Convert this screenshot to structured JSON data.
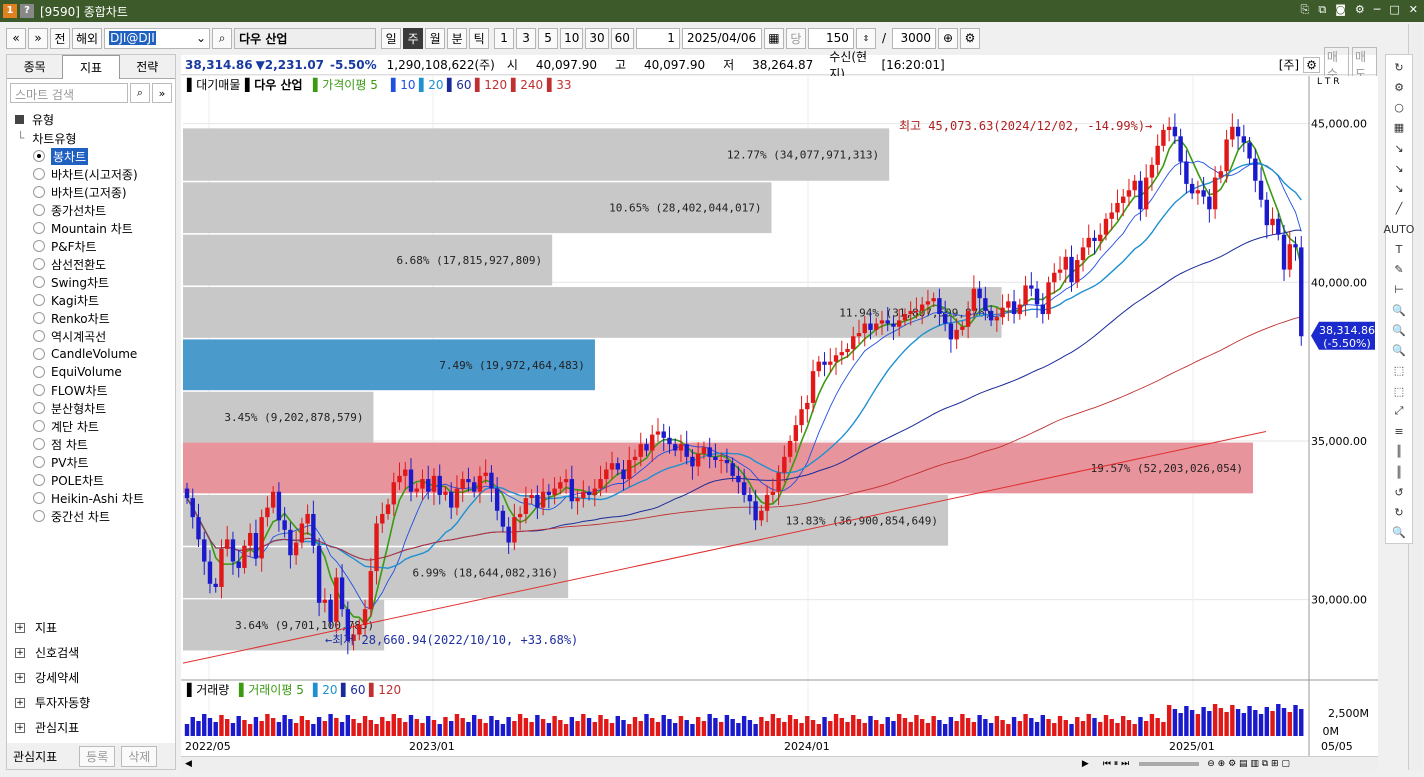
{
  "window": {
    "badge1": "1",
    "badge2": "?",
    "title": "[9590] 종합차트"
  },
  "toolbar": {
    "left_buttons": [
      "«",
      "»",
      "전",
      "해외"
    ],
    "symbol_code": "DJI@DJI",
    "symbol_name": "다우 산업",
    "period_buttons": [
      "일",
      "주",
      "월",
      "분",
      "틱"
    ],
    "period_active": "주",
    "interval_buttons": [
      "1",
      "3",
      "5",
      "10",
      "30",
      "60"
    ],
    "interval_value": "1",
    "date": "2025/04/06",
    "day_label": "당",
    "count": "150",
    "total": "3000",
    "slash": "/"
  },
  "left_panel": {
    "tabs": [
      "종목",
      "지표",
      "전략"
    ],
    "active_tab": "지표",
    "search_placeholder": "스마트 검색",
    "section": "유형",
    "tree_root": "차트유형",
    "chart_types": [
      "봉차트",
      "바차트(시고저종)",
      "바차트(고저종)",
      "종가선차트",
      "Mountain 차트",
      "P&F차트",
      "삼선전환도",
      "Swing차트",
      "Kagi차트",
      "Renko차트",
      "역시계곡선",
      "CandleVolume",
      "EquiVolume",
      "FLOW차트",
      "분산형차트",
      "계단 차트",
      "점 차트",
      "PV차트",
      "POLE차트",
      "Heikin-Ashi 차트",
      "중간선 차트"
    ],
    "selected_type": "봉차트",
    "bottom_sections": [
      "지표",
      "신호검색",
      "강세약세",
      "투자자동향",
      "관심지표"
    ],
    "footer": {
      "label": "관심지표",
      "register": "등록",
      "delete": "삭제"
    }
  },
  "infobar": {
    "price": "38,314.86",
    "change": "▼2,231.07",
    "rate": "-5.50%",
    "volume": "1,290,108,622(주)",
    "open_label": "시",
    "open": "40,097.90",
    "high_label": "고",
    "high": "40,097.90",
    "low_label": "저",
    "low": "38,264.87",
    "feed": "수신(현지)",
    "time": "[16:20:01]",
    "unit": "[주]",
    "buy": "매수",
    "sell": "매도"
  },
  "chart_legend": {
    "type": "대기매물",
    "name": "다우 산업",
    "ma_label": "가격이평",
    "ma_periods": [
      "5",
      "10",
      "20",
      "60",
      "120",
      "240",
      "33"
    ],
    "ma_colors": [
      "#3a9a10",
      "#2050e0",
      "#2090d0",
      "#1a2a9a",
      "#c03030",
      "#c03030",
      "#c03030"
    ]
  },
  "chart_data": {
    "type": "candlestick",
    "price_axis": {
      "ticks": [
        "45,000.00",
        "40,000.00",
        "35,000.00",
        "30,000.00"
      ],
      "tick_values": [
        45000,
        40000,
        35000,
        30000
      ],
      "range": [
        27500,
        46500
      ]
    },
    "time_axis": [
      "2022/05",
      "2023/01",
      "2024/01",
      "2025/01",
      "05/05"
    ],
    "current_price": "38,314.86",
    "current_rate": "(-5.50%)",
    "high_annotation": "최고 45,073.63(2024/12/02, -14.99%)→",
    "low_annotation": "←최저 28,660.94(2022/10/10, +33.68%)",
    "volume_profile": [
      {
        "range": [
          43200,
          44850
        ],
        "width": 0.66,
        "label": "12.77% (34,077,971,313)"
      },
      {
        "range": [
          41550,
          43150
        ],
        "width": 0.55,
        "label": "10.65% (28,402,044,017)"
      },
      {
        "range": [
          39900,
          41500
        ],
        "width": 0.345,
        "label": "6.68% (17,815,927,809)"
      },
      {
        "range": [
          38250,
          39850
        ],
        "width": 0.765,
        "label": "11.94% (31,807,599,876)"
      },
      {
        "range": [
          36600,
          38200
        ],
        "width": 0.385,
        "label": "7.49% (19,972,464,483)",
        "highlight": "blue"
      },
      {
        "range": [
          34950,
          36550
        ],
        "width": 0.178,
        "label": "3.45% (9,202,878,579)"
      },
      {
        "range": [
          33350,
          34950
        ],
        "width": 1.0,
        "label": "19.57% (52,203,026,054)",
        "highlight": "red"
      },
      {
        "range": [
          31700,
          33300
        ],
        "width": 0.715,
        "label": "13.83% (36,900,854,649)"
      },
      {
        "range": [
          30050,
          31650
        ],
        "width": 0.36,
        "label": "6.99% (18,644,082,316)"
      },
      {
        "range": [
          28400,
          30000
        ],
        "width": 0.188,
        "label": "3.64% (9,701,100,783)"
      }
    ],
    "closes": [
      33200,
      32600,
      31900,
      31200,
      30500,
      30400,
      31600,
      31900,
      31200,
      31000,
      31700,
      32100,
      31300,
      32600,
      32900,
      33400,
      32500,
      32200,
      31400,
      31800,
      32400,
      32700,
      31700,
      29900,
      30000,
      29300,
      30700,
      29700,
      28700,
      28900,
      29200,
      29700,
      30900,
      32400,
      32700,
      33000,
      33700,
      33900,
      34100,
      33400,
      33500,
      33800,
      33400,
      33900,
      33300,
      33400,
      32900,
      33500,
      33800,
      33700,
      33400,
      33900,
      34000,
      33500,
      32800,
      32300,
      31800,
      32600,
      32700,
      33200,
      33300,
      32900,
      33400,
      33300,
      33500,
      33700,
      33800,
      33100,
      33200,
      33400,
      33300,
      33500,
      33800,
      34100,
      34300,
      34100,
      33800,
      34400,
      34500,
      34900,
      34700,
      35200,
      35300,
      35100,
      34900,
      34700,
      34900,
      34500,
      34200,
      34600,
      34800,
      34500,
      34400,
      34400,
      34300,
      33900,
      33700,
      33300,
      33100,
      32500,
      32800,
      33300,
      33400,
      34000,
      34500,
      35000,
      35500,
      36000,
      36200,
      37200,
      37500,
      37400,
      37500,
      37700,
      37800,
      37900,
      38300,
      38400,
      38700,
      38500,
      38700,
      38800,
      38700,
      38600,
      38800,
      39000,
      39100,
      39100,
      39300,
      39400,
      39500,
      39000,
      38700,
      38200,
      38500,
      38600,
      39100,
      39800,
      39500,
      39100,
      38800,
      38900,
      39200,
      39400,
      39000,
      39300,
      39900,
      39800,
      39300,
      39000,
      40000,
      40300,
      40400,
      40800,
      40000,
      40700,
      41100,
      41400,
      41300,
      41500,
      42000,
      42200,
      42500,
      42700,
      42900,
      43200,
      42300,
      43300,
      43700,
      44300,
      44800,
      44900,
      44600,
      43800,
      43100,
      42800,
      42900,
      42700,
      42300,
      43300,
      43500,
      44500,
      44900,
      44600,
      44400,
      43900,
      43200,
      42600,
      41800,
      42000,
      41500,
      40400,
      41200,
      41100,
      38300
    ],
    "volume_axis": {
      "ticks": [
        "2,500M",
        "0M"
      ]
    },
    "volume_legend": {
      "type": "거래량",
      "ma_label": "거래이평",
      "ma_periods": [
        "5",
        "20",
        "60",
        "120"
      ],
      "ma_colors": [
        "#3a9a10",
        "#2090d0",
        "#1a2a9a",
        "#c03030"
      ]
    }
  },
  "right_tools": [
    "↻",
    "⚙",
    "○",
    "▦",
    "↘",
    "↘",
    "↘",
    "╱",
    "AUTO",
    "T",
    "✎",
    "⊢",
    "🔍",
    "🔍",
    "🔍",
    "⬚",
    "⬚",
    "⤢",
    "≡",
    "║",
    "║",
    "↺",
    "↻",
    "🔍"
  ]
}
